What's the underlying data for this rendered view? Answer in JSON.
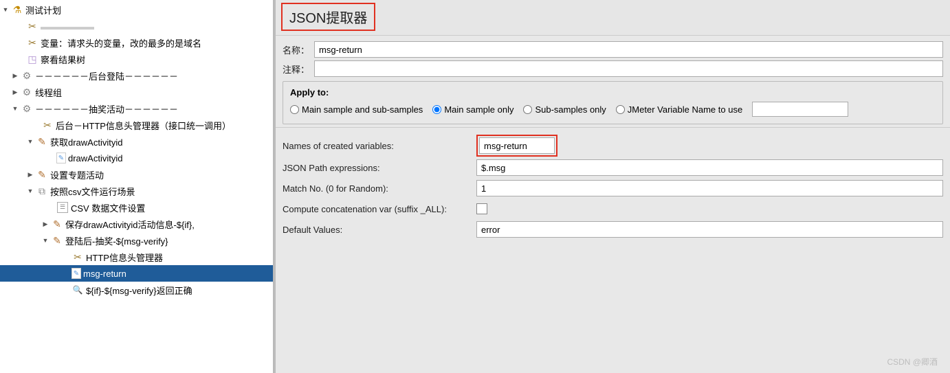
{
  "tree": {
    "root": "测试计划",
    "node_blurred": "▬▬▬▬▬▬",
    "var_node": "变量：请求头的变量，改的最多的是域名",
    "result_tree": "察看结果树",
    "login_group": "－－－－－－后台登陆－－－－－－",
    "thread_group": "线程组",
    "lottery_group": "－－－－－－抽奖活动－－－－－－",
    "http_header_mgr": "后台－HTTP信息头管理器（接口统一调用）",
    "get_draw": "获取drawActivityid",
    "draw_activity": "drawActivityid",
    "set_topic": "设置专题活动",
    "csv_scene": "按照csv文件运行场景",
    "csv_data": "CSV 数据文件设置",
    "save_draw": "保存drawActivityid活动信息-${if},",
    "login_after": "登陆后-抽奖-${msg-verify}",
    "http_header": "HTTP信息头管理器",
    "msg_return": "msg-return",
    "if_verify": "${if}-${msg-verify}返回正确"
  },
  "panel": {
    "title": "JSON提取器",
    "name_label": "名称：",
    "name_value": "msg-return",
    "comment_label": "注释：",
    "comment_value": "",
    "apply_legend": "Apply to:",
    "radio_main_sub": "Main sample and sub-samples",
    "radio_main": "Main sample only",
    "radio_sub": "Sub-samples only",
    "radio_var": "JMeter Variable Name to use",
    "var_value": "",
    "names_label": "Names of created variables:",
    "names_value": "msg-return",
    "json_path_label": "JSON Path expressions:",
    "json_path_value": "$.msg",
    "match_label": "Match No. (0 for Random):",
    "match_value": "1",
    "concat_label": "Compute concatenation var (suffix _ALL):",
    "default_label": "Default Values:",
    "default_value": "error"
  },
  "watermark": "CSDN @卿酒"
}
